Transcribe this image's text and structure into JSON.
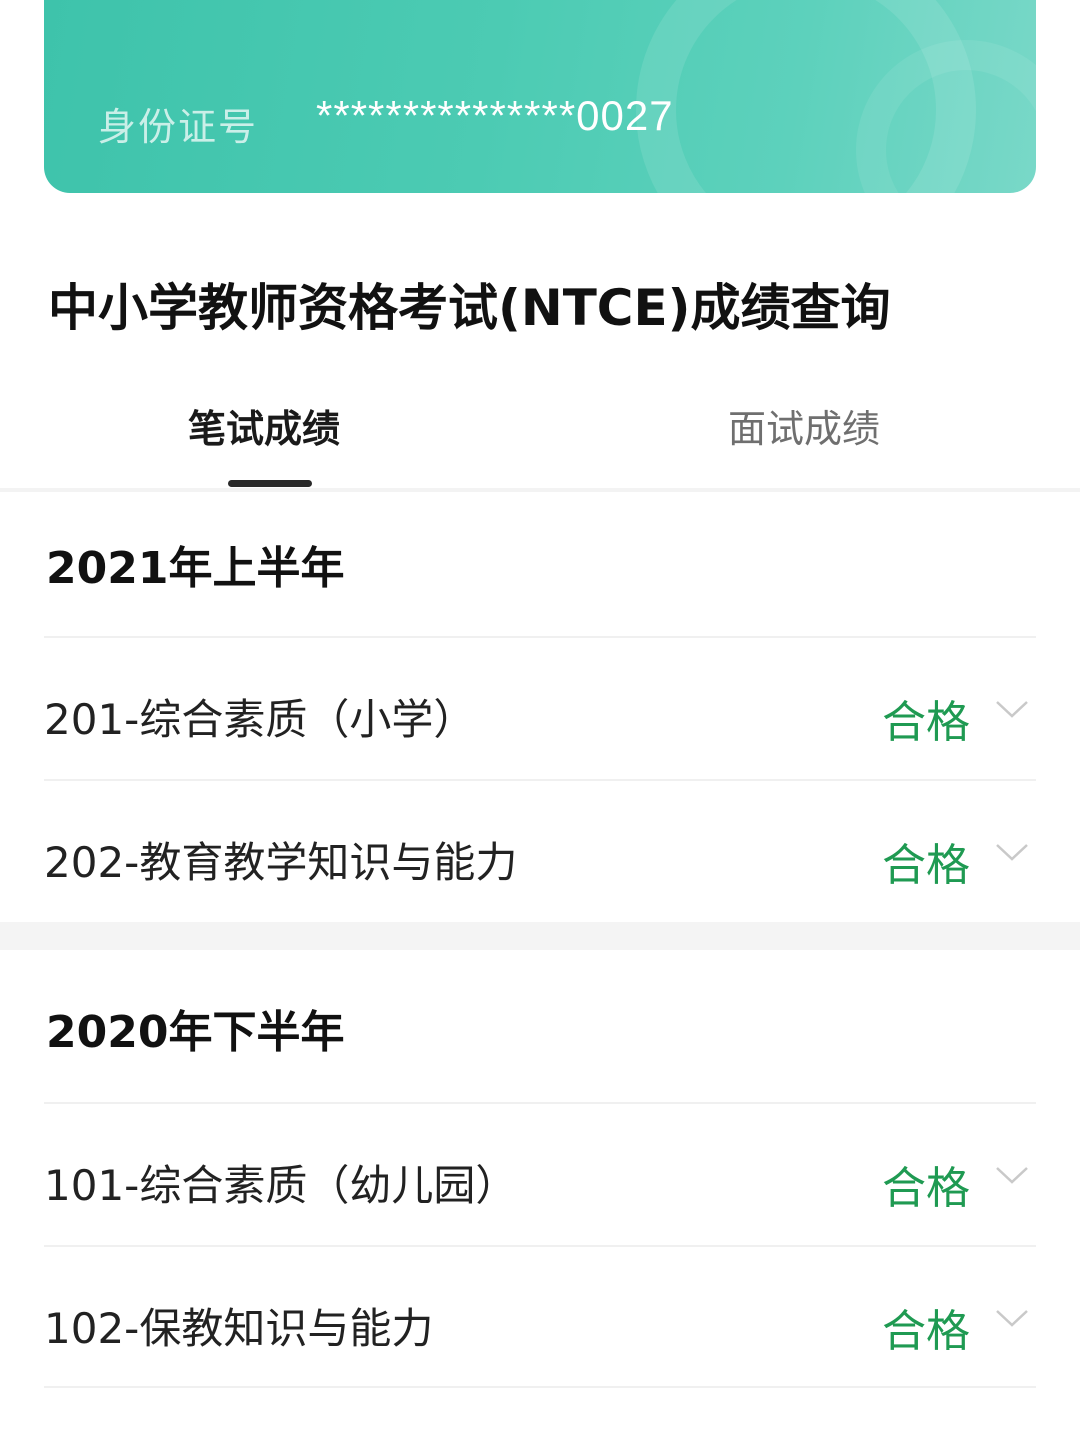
{
  "id_card": {
    "label": "身份证号",
    "number": "***************0027",
    "background_color": "#46c7af"
  },
  "page_title": "中小学教师资格考试(NTCE)成绩查询",
  "tabs": [
    {
      "label": "笔试成绩",
      "active": true
    },
    {
      "label": "面试成绩",
      "active": false
    }
  ],
  "sections": [
    {
      "title": "2021年上半年",
      "items": [
        {
          "label": "201-综合素质（小学）",
          "status": "合格",
          "icon": "chevron-down-icon"
        },
        {
          "label": "202-教育教学知识与能力",
          "status": "合格",
          "icon": "chevron-down-icon"
        }
      ]
    },
    {
      "title": "2020年下半年",
      "items": [
        {
          "label": "101-综合素质（幼儿园）",
          "status": "合格",
          "icon": "chevron-down-icon"
        },
        {
          "label": "102-保教知识与能力",
          "status": "合格",
          "icon": "chevron-down-icon"
        }
      ]
    }
  ],
  "colors": {
    "pass_status": "#1f9a52",
    "active_tab": "#1a1a1a",
    "inactive_tab": "#6f6f6f"
  }
}
